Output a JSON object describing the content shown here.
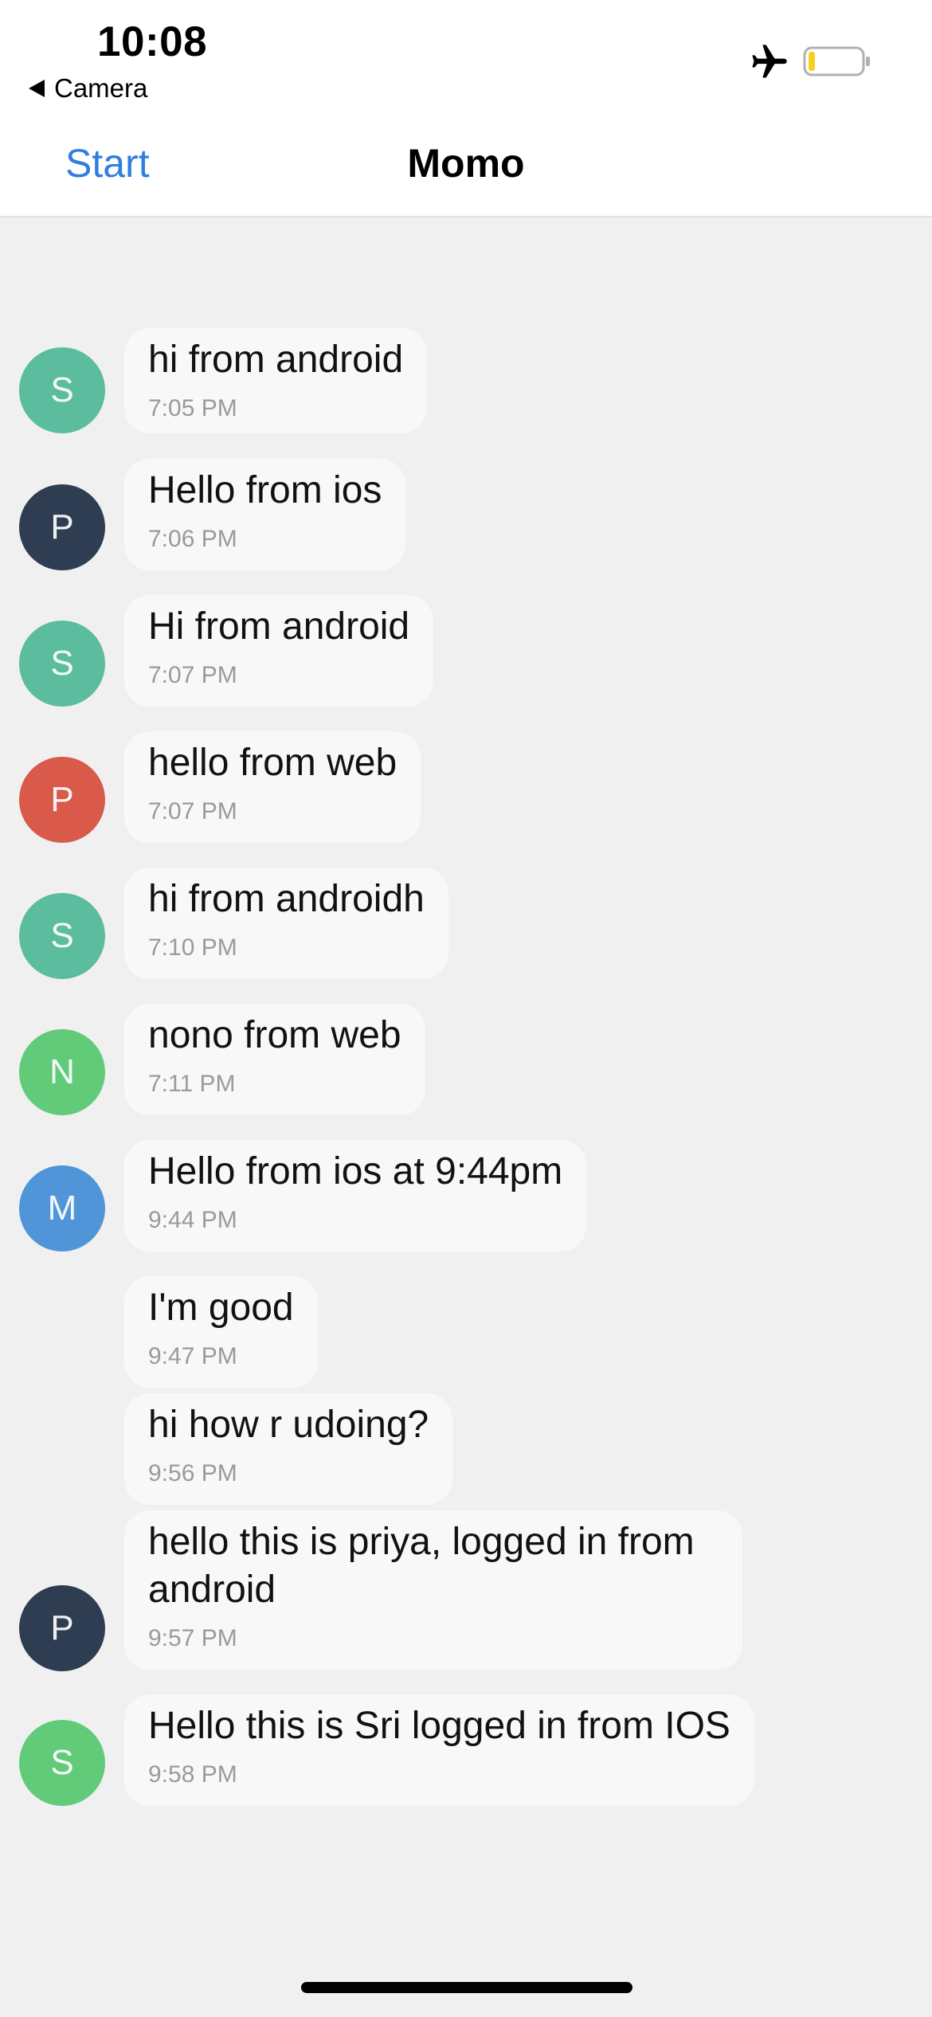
{
  "status_bar": {
    "time": "10:08",
    "back_app": "Camera",
    "icons": [
      "airplane-icon",
      "battery-icon"
    ],
    "battery_color": "#f5d020"
  },
  "nav": {
    "left_button": "Start",
    "title": "Momo",
    "accent_color": "#2f7ee0"
  },
  "messages": [
    {
      "avatar": "S",
      "avatar_color": "#5bbd9e",
      "text": "hi from android",
      "time": "7:05 PM"
    },
    {
      "avatar": "P",
      "avatar_color": "#2e3d52",
      "text": "Hello from ios",
      "time": "7:06 PM"
    },
    {
      "avatar": "S",
      "avatar_color": "#5bbd9e",
      "text": "Hi from android",
      "time": "7:07 PM"
    },
    {
      "avatar": "P",
      "avatar_color": "#d9594b",
      "text": "hello from web",
      "time": "7:07 PM"
    },
    {
      "avatar": "S",
      "avatar_color": "#5bbd9e",
      "text": "hi from androidh",
      "time": "7:10 PM"
    },
    {
      "avatar": "N",
      "avatar_color": "#62cb7a",
      "text": "nono from web",
      "time": "7:11 PM"
    },
    {
      "avatar": "M",
      "avatar_color": "#4f95d8",
      "text": "Hello from ios at 9:44pm",
      "time": "9:44 PM"
    },
    {
      "avatar": "",
      "avatar_color": "",
      "text": "I'm good",
      "time": "9:47 PM"
    },
    {
      "avatar": "",
      "avatar_color": "",
      "text": "hi how r udoing?",
      "time": "9:56 PM"
    },
    {
      "avatar": "P",
      "avatar_color": "#2e3d52",
      "text": "hello this is priya, logged in from android",
      "time": "9:57 PM"
    },
    {
      "avatar": "S",
      "avatar_color": "#62cb7a",
      "text": "Hello this is Sri logged in from IOS",
      "time": "9:58 PM"
    }
  ]
}
